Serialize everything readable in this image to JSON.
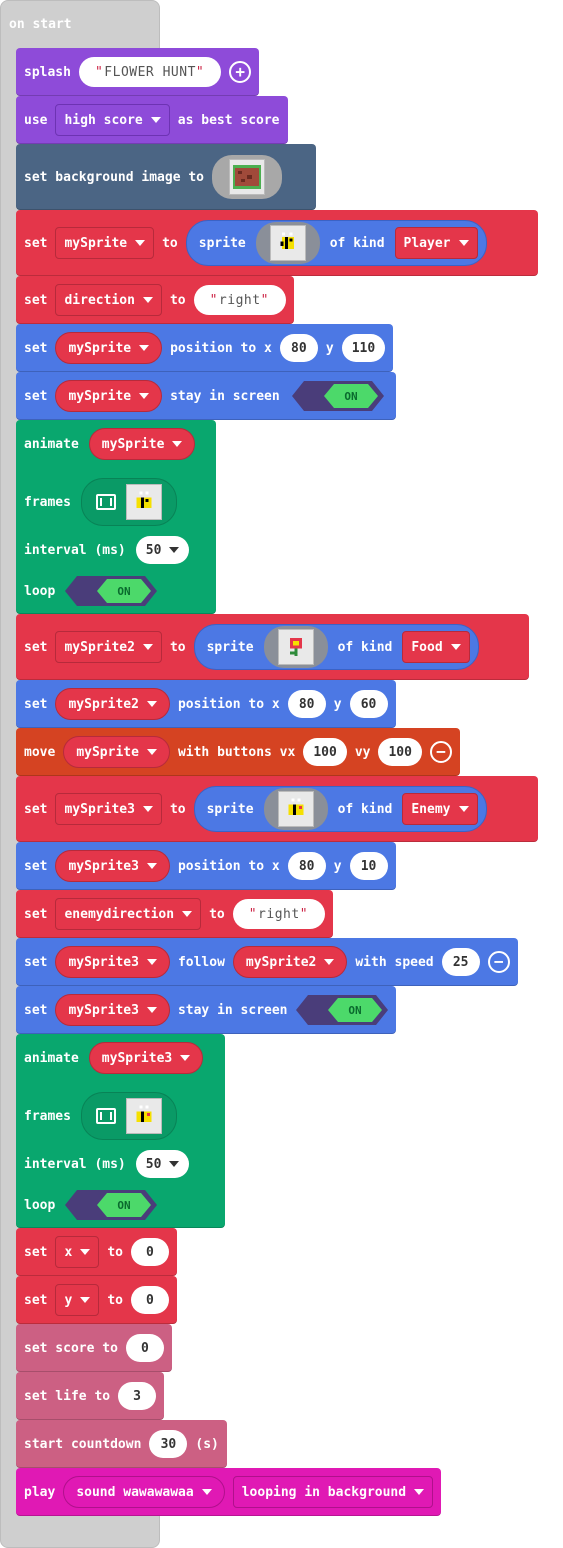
{
  "hat": {
    "label": "on start"
  },
  "splash": {
    "label": "splash",
    "text": "FLOWER HUNT"
  },
  "use": {
    "label": "use",
    "option": "high score",
    "suffix": "as best score"
  },
  "background": {
    "label": "set background image to"
  },
  "set_sprite1": {
    "set": "set",
    "var": "mySprite",
    "to": "to",
    "sprite": "sprite",
    "of_kind": "of kind",
    "kind": "Player"
  },
  "set_direction": {
    "set": "set",
    "var": "direction",
    "to": "to",
    "value": "right"
  },
  "pos1": {
    "set": "set",
    "var": "mySprite",
    "label": "position to x",
    "x": "80",
    "y_label": "y",
    "y": "110"
  },
  "stay1": {
    "set": "set",
    "var": "mySprite",
    "label": "stay in screen",
    "toggle": "ON"
  },
  "animate1": {
    "animate": "animate",
    "var": "mySprite",
    "frames": "frames",
    "interval": "interval (ms)",
    "interval_value": "50",
    "loop": "loop",
    "toggle": "ON"
  },
  "set_sprite2": {
    "set": "set",
    "var": "mySprite2",
    "to": "to",
    "sprite": "sprite",
    "of_kind": "of kind",
    "kind": "Food"
  },
  "pos2": {
    "set": "set",
    "var": "mySprite2",
    "label": "position to x",
    "x": "80",
    "y_label": "y",
    "y": "60"
  },
  "move": {
    "move": "move",
    "var": "mySprite",
    "with": "with buttons vx",
    "vx": "100",
    "vy_label": "vy",
    "vy": "100"
  },
  "set_sprite3": {
    "set": "set",
    "var": "mySprite3",
    "to": "to",
    "sprite": "sprite",
    "of_kind": "of kind",
    "kind": "Enemy"
  },
  "pos3": {
    "set": "set",
    "var": "mySprite3",
    "label": "position to x",
    "x": "80",
    "y_label": "y",
    "y": "10"
  },
  "set_enemydir": {
    "set": "set",
    "var": "enemydirection",
    "to": "to",
    "value": "right"
  },
  "follow": {
    "set": "set",
    "var": "mySprite3",
    "follow": "follow",
    "target": "mySprite2",
    "with_speed": "with speed",
    "speed": "25"
  },
  "stay3": {
    "set": "set",
    "var": "mySprite3",
    "label": "stay in screen",
    "toggle": "ON"
  },
  "animate3": {
    "animate": "animate",
    "var": "mySprite3",
    "frames": "frames",
    "interval": "interval (ms)",
    "interval_value": "50",
    "loop": "loop",
    "toggle": "ON"
  },
  "set_x": {
    "set": "set",
    "var": "x",
    "to": "to",
    "value": "0"
  },
  "set_y": {
    "set": "set",
    "var": "y",
    "to": "to",
    "value": "0"
  },
  "score": {
    "label": "set score to",
    "value": "0"
  },
  "life": {
    "label": "set life to",
    "value": "3"
  },
  "countdown": {
    "label": "start countdown",
    "value": "30",
    "unit": "(s)"
  },
  "play": {
    "label": "play",
    "sound": "sound wawawawaa",
    "mode": "looping in background"
  },
  "colors": {
    "purple": "#8e4bd9",
    "slate": "#4b6584",
    "red": "#e4364a",
    "blue": "#4c78e4",
    "green": "#09a76e",
    "orange": "#d54322",
    "pink": "#cc6083",
    "magenta": "#e019b4"
  },
  "icons": [
    "plus-circle-icon",
    "minus-circle-icon",
    "dropdown-caret-icon",
    "film-strip-icon",
    "bee-sprite-image",
    "flower-sprite-image",
    "background-image-thumbnail"
  ]
}
